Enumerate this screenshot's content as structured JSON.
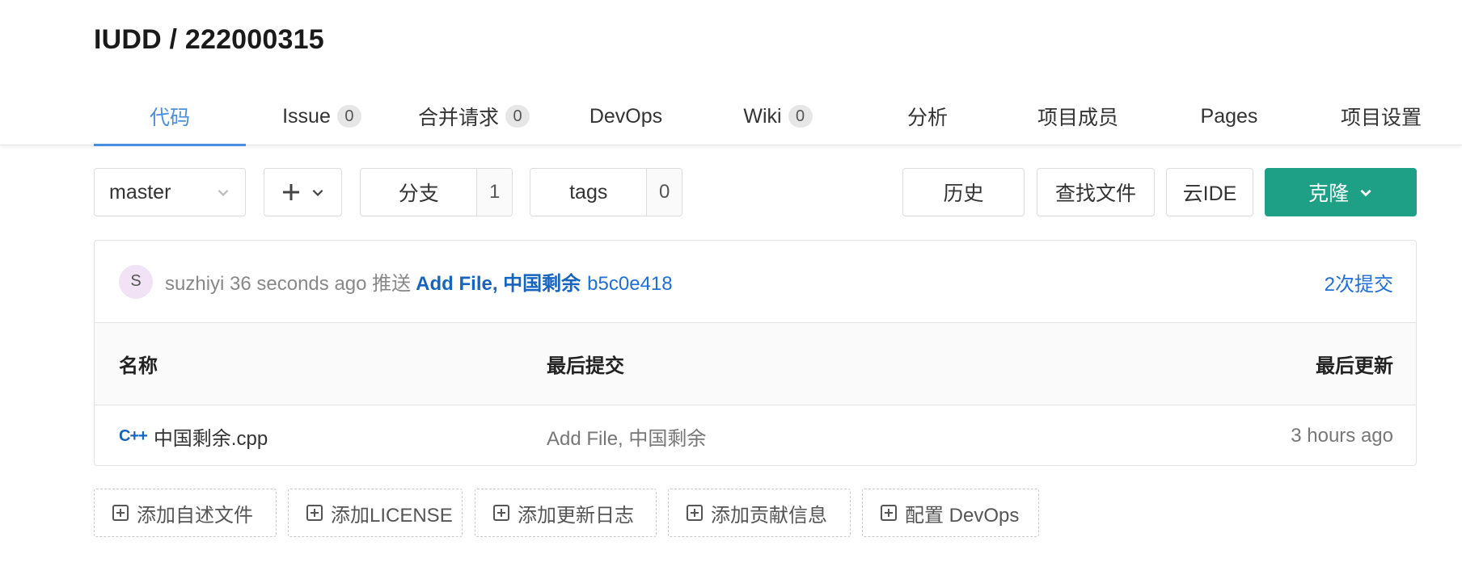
{
  "repo": {
    "title": "IUDD / 222000315"
  },
  "tabs": [
    {
      "label": "代码",
      "badge": null
    },
    {
      "label": "Issue",
      "badge": "0"
    },
    {
      "label": "合并请求",
      "badge": "0"
    },
    {
      "label": "DevOps",
      "badge": null
    },
    {
      "label": "Wiki",
      "badge": "0"
    },
    {
      "label": "分析",
      "badge": null
    },
    {
      "label": "项目成员",
      "badge": null
    },
    {
      "label": "Pages",
      "badge": null
    },
    {
      "label": "项目设置",
      "badge": null
    }
  ],
  "toolbar": {
    "branch": "master",
    "branches_label": "分支",
    "branches_count": "1",
    "tags_label": "tags",
    "tags_count": "0",
    "history": "历史",
    "find_file": "查找文件",
    "cloud_ide": "云IDE",
    "clone": "克隆"
  },
  "commit": {
    "avatar": "S",
    "meta": "suzhiyi 36 seconds ago 推送",
    "message": "Add File, 中国剩余",
    "hash": "b5c0e418",
    "count": "2次提交"
  },
  "table": {
    "headers": [
      "名称",
      "最后提交",
      "最后更新"
    ],
    "rows": [
      {
        "icon": "C++",
        "name": "中国剩余.cpp",
        "last_commit": "Add File, 中国剩余",
        "updated": "3 hours ago"
      }
    ]
  },
  "add_buttons": [
    "添加自述文件",
    "添加LICENSE",
    "添加更新日志",
    "添加贡献信息",
    "配置 DevOps"
  ],
  "colors": {
    "accent": "#4a90e2",
    "primary": "#1ea087",
    "link": "#1e6fd9"
  }
}
